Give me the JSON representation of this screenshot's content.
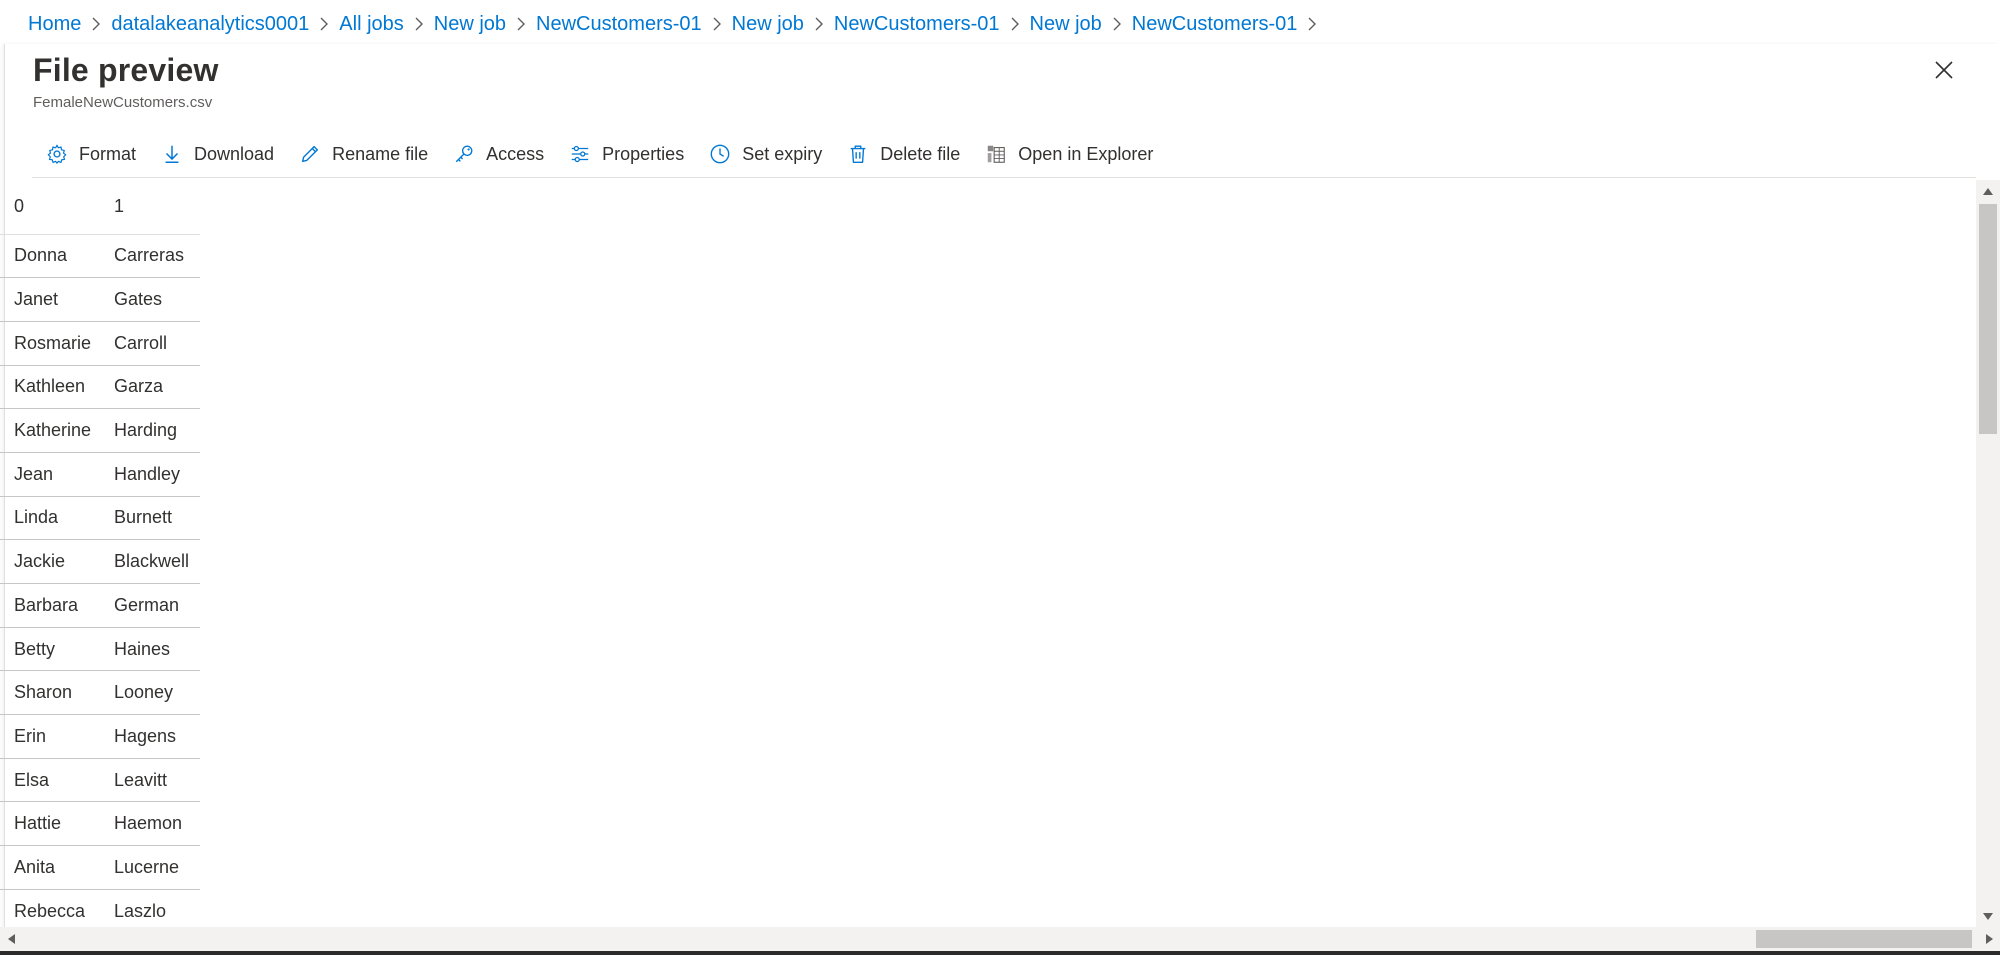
{
  "breadcrumb": [
    {
      "label": "Home"
    },
    {
      "label": "datalakeanalytics0001"
    },
    {
      "label": "All jobs"
    },
    {
      "label": "New job"
    },
    {
      "label": "NewCustomers-01"
    },
    {
      "label": "New job"
    },
    {
      "label": "NewCustomers-01"
    },
    {
      "label": "New job"
    },
    {
      "label": "NewCustomers-01"
    }
  ],
  "blade": {
    "title": "File preview",
    "subtitle": "FemaleNewCustomers.csv"
  },
  "toolbar": {
    "format": "Format",
    "download": "Download",
    "rename": "Rename file",
    "access": "Access",
    "properties": "Properties",
    "set_expiry": "Set expiry",
    "delete": "Delete file",
    "open_explorer": "Open in Explorer"
  },
  "colors": {
    "accent": "#0078d4",
    "text": "#323130",
    "muted": "#605e5c",
    "border": "#e1dfdd"
  },
  "grid": {
    "columns": [
      "0",
      "1"
    ],
    "rows": [
      [
        "Donna",
        "Carreras"
      ],
      [
        "Janet",
        "Gates"
      ],
      [
        "Rosmarie",
        "Carroll"
      ],
      [
        "Kathleen",
        "Garza"
      ],
      [
        "Katherine",
        "Harding"
      ],
      [
        "Jean",
        "Handley"
      ],
      [
        "Linda",
        "Burnett"
      ],
      [
        "Jackie",
        "Blackwell"
      ],
      [
        "Barbara",
        "German"
      ],
      [
        "Betty",
        "Haines"
      ],
      [
        "Sharon",
        "Looney"
      ],
      [
        "Erin",
        "Hagens"
      ],
      [
        "Elsa",
        "Leavitt"
      ],
      [
        "Hattie",
        "Haemon"
      ],
      [
        "Anita",
        "Lucerne"
      ],
      [
        "Rebecca",
        "Laszlo"
      ]
    ]
  }
}
